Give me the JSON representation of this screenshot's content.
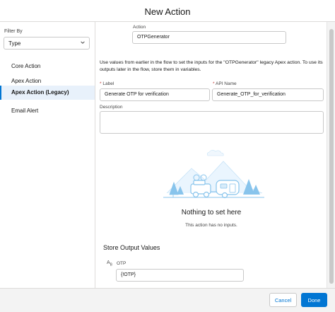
{
  "modal": {
    "title": "New Action"
  },
  "sidebar": {
    "filter_label": "Filter By",
    "filter_value": "Type",
    "items": [
      {
        "label": "Core Action"
      },
      {
        "label": "Apex Action"
      },
      {
        "label": "Apex Action (Legacy)",
        "selected": true
      },
      {
        "label": "Email Alert"
      }
    ]
  },
  "main": {
    "action_label": "Action",
    "action_value": "OTPGenerator",
    "help_text": "Use values from earlier in the flow to set the inputs for the \"OTPGenerator\" legacy Apex action. To use its outputs later in the flow, store them in variables.",
    "label_field": {
      "required": "*",
      "label": "Label",
      "value": "Generate OTP for verification"
    },
    "api_field": {
      "required": "*",
      "label": "API Name",
      "value": "Generate_OTP_for_verification"
    },
    "description_label": "Description",
    "description_value": "",
    "empty_state": {
      "title": "Nothing to set here",
      "subtitle": "This action has no inputs."
    },
    "output_section": {
      "title": "Store Output Values",
      "type_icon": "text-type-icon",
      "type_icon_text": "A",
      "type_icon_sub": "B",
      "output_label": "OTP",
      "output_value": "{!OTP}"
    }
  },
  "footer": {
    "cancel_label": "Cancel",
    "done_label": "Done"
  },
  "colors": {
    "brand": "#0176d3",
    "selected_bg": "#e8f1fb",
    "border": "#dddbda",
    "required": "#c23934",
    "illustration": "#88c4ec"
  }
}
